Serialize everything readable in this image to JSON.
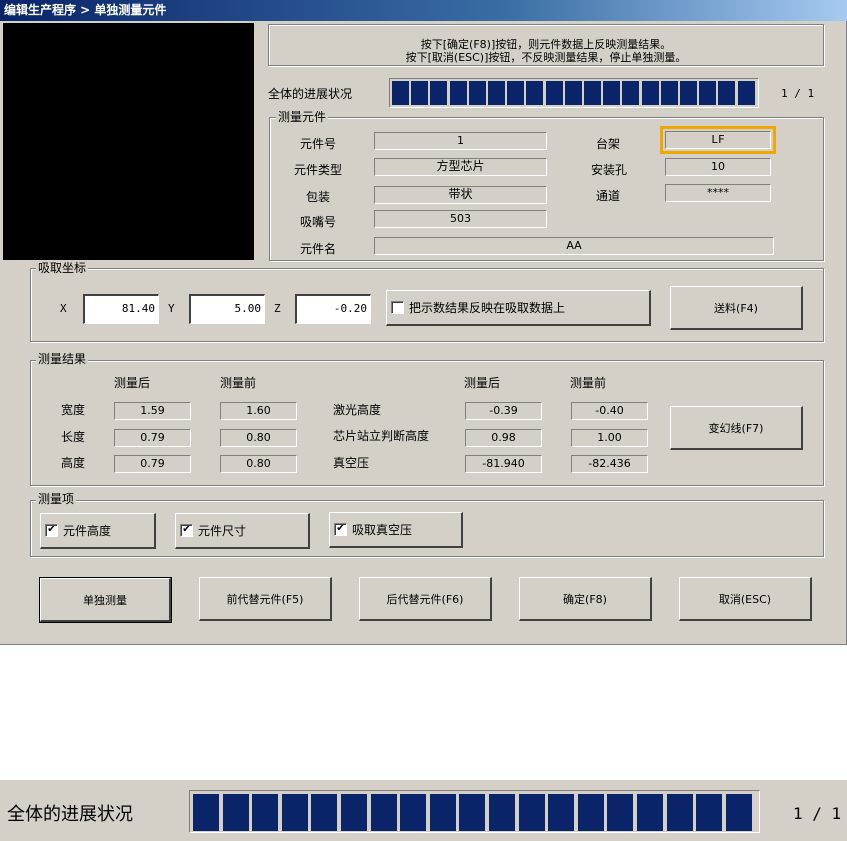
{
  "window": {
    "title": "编辑生产程序 > 单独测量元件"
  },
  "message": {
    "line1": "按下[确定(F8)]按钮，则元件数据上反映测量结果。",
    "line2": "按下[取消(ESC)]按钮，不反映测量结果，停止单独测量。"
  },
  "progress": {
    "label": "全体的进展状况",
    "counter": "1 / 1",
    "fraction": 1.0,
    "segments": 19
  },
  "component_group": {
    "title": "测量元件",
    "part_no_label": "元件号",
    "part_no": "1",
    "part_type_label": "元件类型",
    "part_type": "方型芯片",
    "package_label": "包装",
    "package": "带状",
    "nozzle_label": "吸嘴号",
    "nozzle": "503",
    "name_label": "元件名",
    "name": "AA",
    "rack_label": "台架",
    "rack": "LF",
    "hole_label": "安装孔",
    "hole": "10",
    "channel_label": "通道",
    "channel": "****"
  },
  "pickup_group": {
    "title": "吸取坐标",
    "x_label": "X",
    "x": "81.40",
    "y_label": "Y",
    "y": "5.00",
    "z_label": "Z",
    "z": "-0.20",
    "reflect_label": "把示数结果反映在吸取数据上",
    "reflect_checked": false,
    "feed_button": "送料(F4)"
  },
  "results_group": {
    "title": "测量结果",
    "after_header": "测量后",
    "before_header": "测量前",
    "after_header2": "测量后",
    "before_header2": "测量前",
    "width_label": "宽度",
    "width_after": "1.59",
    "width_before": "1.60",
    "length_label": "长度",
    "length_after": "0.79",
    "length_before": "0.80",
    "height_label": "高度",
    "height_after": "0.79",
    "height_before": "0.80",
    "laser_label": "激光高度",
    "laser_after": "-0.39",
    "laser_before": "-0.40",
    "stand_label": "芯片站立判断高度",
    "stand_after": "0.98",
    "stand_before": "1.00",
    "vacuum_label": "真空压",
    "vacuum_after": "-81.940",
    "vacuum_before": "-82.436",
    "change_button": "变幻线(F7)"
  },
  "items_group": {
    "title": "测量项",
    "item1": "元件高度",
    "item1_checked": true,
    "item2": "元件尺寸",
    "item2_checked": true,
    "item3": "吸取真空压",
    "item3_checked": true
  },
  "buttons": {
    "single": "单独测量",
    "prev": "前代替元件(F5)",
    "next": "后代替元件(F6)",
    "ok": "确定(F8)",
    "cancel": "取消(ESC)"
  },
  "check_mark": "✔",
  "colors": {
    "progress_fill": "#0a246a",
    "highlight": "#f0a800",
    "dialog_bg": "#d4d0c8"
  }
}
